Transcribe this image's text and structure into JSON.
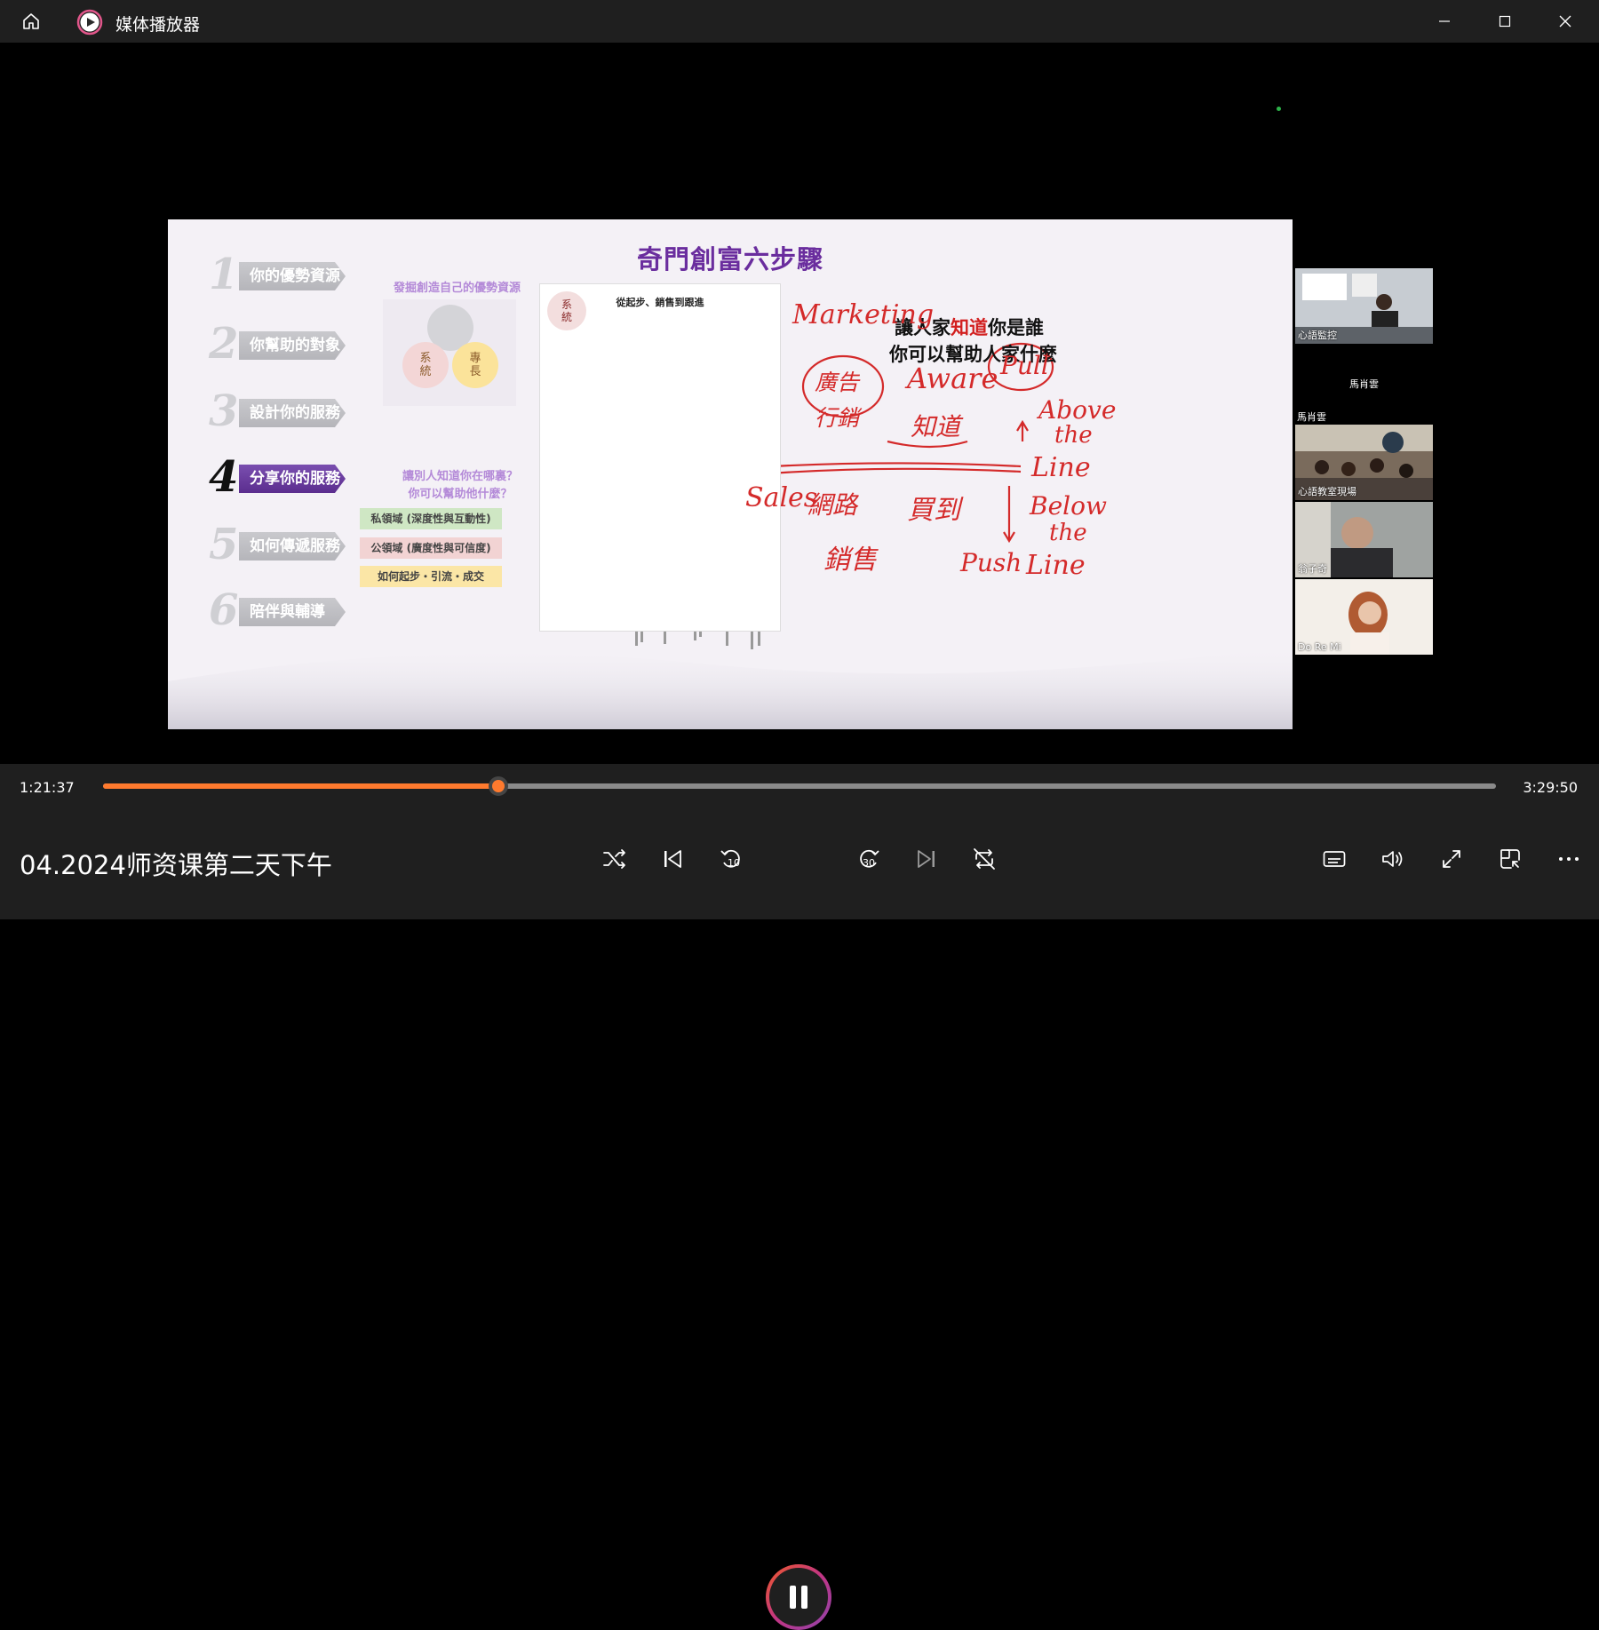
{
  "window": {
    "title": "媒体播放器",
    "controls": [
      "minimize-icon",
      "maximize-icon",
      "close-icon"
    ]
  },
  "slide": {
    "title": "奇門創富六步驟",
    "steps": [
      {
        "num": "1",
        "label": "你的優勢資源",
        "active": false
      },
      {
        "num": "2",
        "label": "你幫助的對象",
        "active": false
      },
      {
        "num": "3",
        "label": "設計你的服務",
        "active": false
      },
      {
        "num": "4",
        "label": "分享你的服務",
        "active": true
      },
      {
        "num": "5",
        "label": "如何傳遞服務",
        "active": false
      },
      {
        "num": "6",
        "label": "陪伴與輔導",
        "active": false
      }
    ],
    "advantage_subtitle": "發掘創造自己的優勢資源",
    "venn": {
      "system": "系\n統",
      "expertise": "專\n長"
    },
    "share_question_1": "讓別人知道你在哪裏？",
    "share_question_2": "你可以幫助他什麼？",
    "tags": [
      "私領域 (深度性與互動性)",
      "公領域 (廣度性與可信度)",
      "如何起步・引流・成交"
    ],
    "tag_colors": [
      "#cfe7c4",
      "#f2d3d3",
      "#fbe6a6"
    ],
    "flow_title": "從起步、銷售到跟進",
    "flow_badge": "系\n統",
    "line1_prefix": "讓人家",
    "line1_highlight": "知道",
    "line1_suffix": "你是誰",
    "line2": "你可以幫助人家什麼",
    "ink_color": "#d42a2a",
    "ink": {
      "marketing": "Marketing",
      "pull": "Pull",
      "aware": "Aware",
      "above": "Above",
      "the1": "the",
      "line1": "Line",
      "below": "Below",
      "the2": "the",
      "line2": "Line",
      "push": "Push",
      "sales": "Sales",
      "guangxiao": "廣告\n行銷",
      "zhidao": "知道",
      "maidao": "買到",
      "xiaoshou": "銷售",
      "wanglu": "網路"
    }
  },
  "participants": [
    {
      "name": "心語監控"
    },
    {
      "name": "馬肖雲"
    },
    {
      "name": "馬肖雲"
    },
    {
      "name": "心語教室現場"
    },
    {
      "name": "翁子奇"
    },
    {
      "name": "Do Re Mi"
    }
  ],
  "player": {
    "current_time": "1:21:37",
    "total_time": "3:29:50",
    "progress": 0.2836,
    "media_title": "04.2024师资课第二天下午",
    "accent_color": "#ff7a2e",
    "buttons": [
      "shuffle-icon",
      "previous-icon",
      "rewind-10-icon",
      "pause-icon",
      "forward-30-icon",
      "next-icon",
      "repeat-off-icon",
      "subtitles-icon",
      "volume-icon",
      "fullscreen-icon",
      "mini-player-icon",
      "more-icon"
    ],
    "rewind_label": "10",
    "forward_label": "30"
  }
}
